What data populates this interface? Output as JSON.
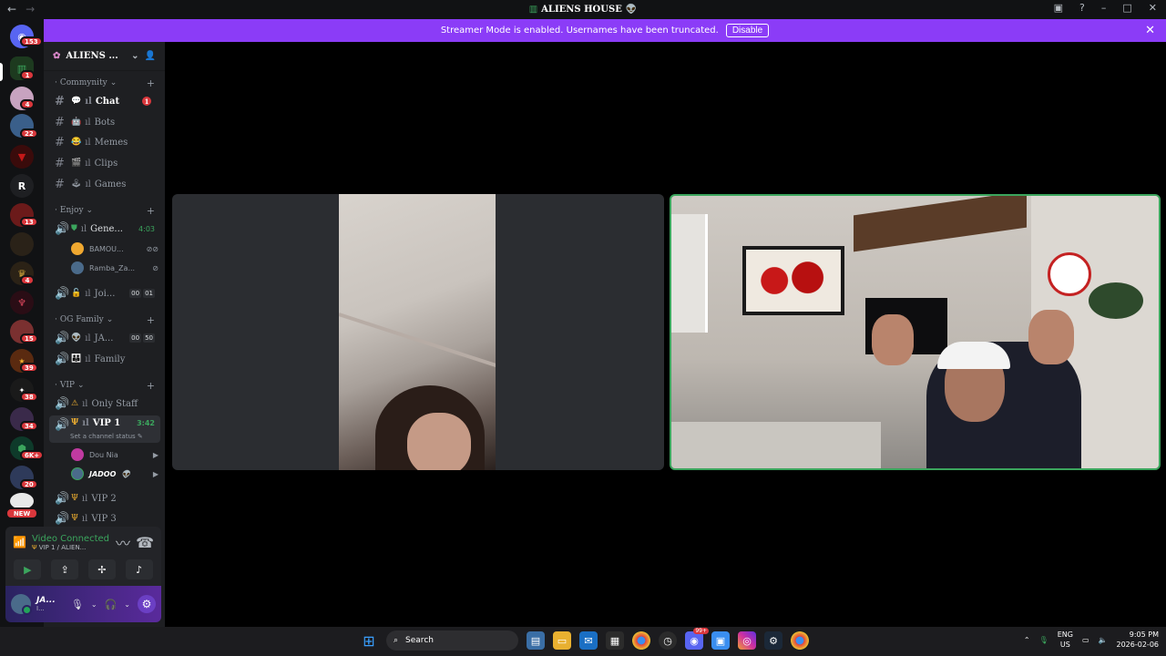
{
  "window": {
    "title": "ALIENS HOUSE",
    "title_emoji": "👽"
  },
  "banner": {
    "text": "Streamer Mode is enabled. Usernames have been truncated.",
    "button": "Disable"
  },
  "servers": [
    {
      "badge": "153"
    },
    {
      "badge": "1"
    },
    {
      "badge": "4"
    },
    {
      "badge": "22"
    },
    {
      "badge": ""
    },
    {
      "letter": "R",
      "badge": ""
    },
    {
      "badge": "13"
    },
    {
      "badge": ""
    },
    {
      "badge": "4"
    },
    {
      "badge": ""
    },
    {
      "badge": "15"
    },
    {
      "badge": "39"
    },
    {
      "badge": "38"
    },
    {
      "badge": "34"
    },
    {
      "badge": "6K+"
    },
    {
      "badge": "20"
    },
    {
      "badge": "NEW"
    }
  ],
  "server_header": {
    "name": "ALIENS ..."
  },
  "categories": {
    "c1": "Commynity",
    "c2": "Enjoy",
    "c3": "OG Family",
    "c4": "VIP"
  },
  "channels": {
    "chat": {
      "label": "Chat",
      "unread": "1"
    },
    "bots": {
      "label": "Bots"
    },
    "memes": {
      "label": "Memes"
    },
    "clips": {
      "label": "Clips"
    },
    "games": {
      "label": "Games"
    },
    "general": {
      "label": "Gene...",
      "time": "4:03"
    },
    "join": {
      "label": "Joi...",
      "count_a": "00",
      "count_b": "01"
    },
    "ja": {
      "label": "JA...",
      "count_a": "00",
      "count_b": "50"
    },
    "family": {
      "label": "Family"
    },
    "staff": {
      "label": "Only Staff"
    },
    "vip1": {
      "label": "VIP 1",
      "time": "3:42",
      "status": "Set a channel status"
    },
    "vip2": {
      "label": "VIP 2"
    },
    "vip3": {
      "label": "VIP 3"
    }
  },
  "voice_users": {
    "u1": "BAMOU...",
    "u2": "Ramba_Za...",
    "u3": "Dou Nia",
    "u4": "JADOO"
  },
  "voice_panel": {
    "title": "Video Connected",
    "subtitle": "VIP 1 / ALIEN..."
  },
  "user_panel": {
    "name": "JA...",
    "sub": "I..."
  },
  "taskbar": {
    "search": "Search",
    "lang_top": "ENG",
    "lang_bottom": "US",
    "time": "9:05 PM",
    "date": "2026-02-06",
    "discord_badge": "99+"
  },
  "colors": {
    "accent": "#8b3cf7",
    "voice_green": "#3ba55d",
    "badge_red": "#da373c"
  }
}
